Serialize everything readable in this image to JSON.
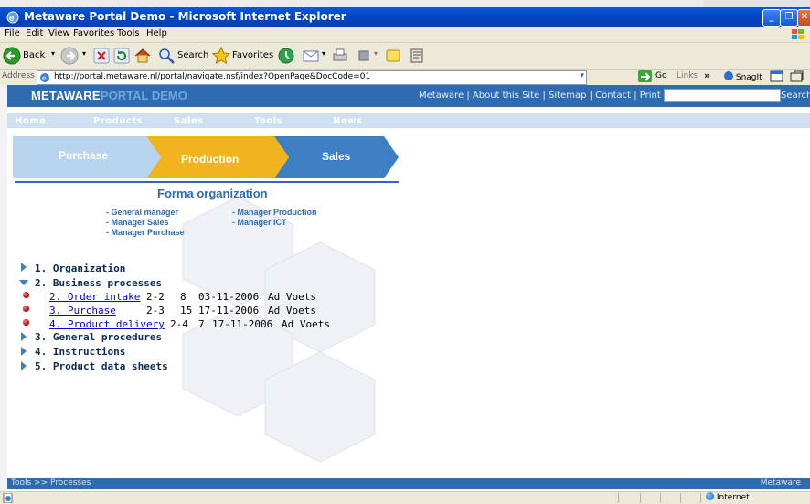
{
  "window": {
    "title": "Metaware Portal Demo - Microsoft Internet Explorer"
  },
  "menu": [
    "File",
    "Edit",
    "View",
    "Favorites",
    "Tools",
    "Help"
  ],
  "toolbar": {
    "back": "Back",
    "search": "Search",
    "favorites": "Favorites"
  },
  "address": {
    "label": "Address",
    "url": "http://portal.metaware.nl/portal/navigate.nsf/index?OpenPage&DocCode=01",
    "go": "Go",
    "links": "Links",
    "snagit": "SnagIt"
  },
  "portal": {
    "logo_part1": "METAWARE",
    "logo_part2": "PORTAL DEMO",
    "top_links": "Metaware | About this Site | Sitemap | Contact | Print",
    "search_label": "Search",
    "nav": [
      "Home",
      "Products",
      "Sales",
      "Tools",
      "News"
    ]
  },
  "process_arrows": [
    {
      "label": "Purchase",
      "color": "#b9d4ee"
    },
    {
      "label": "Production",
      "color": "#f0b41e"
    },
    {
      "label": "Sales",
      "color": "#3d7fc3"
    }
  ],
  "forma": {
    "title": "Forma organization",
    "links": [
      "- General manager",
      "- Manager Sales",
      "- Manager Purchase",
      "- Manager Production",
      "- Manager ICT"
    ]
  },
  "tree": {
    "items": [
      {
        "label": "1. Organization",
        "expanded": false
      },
      {
        "label": "2. Business processes",
        "expanded": true
      },
      {
        "label": "3. General procedures",
        "expanded": false
      },
      {
        "label": "4. Instructions",
        "expanded": false
      },
      {
        "label": "5. Product data sheets",
        "expanded": false
      }
    ],
    "documents": [
      {
        "title": "2. Order intake",
        "code": "2-2",
        "version": "8",
        "date": "03-11-2006",
        "author": "Ad Voets"
      },
      {
        "title": "3. Purchase",
        "code": "2-3",
        "version": "15",
        "date": "17-11-2006",
        "author": "Ad Voets"
      },
      {
        "title": "4. Product delivery",
        "code": "2-4",
        "version": "7",
        "date": "17-11-2006",
        "author": "Ad Voets"
      }
    ]
  },
  "footer": {
    "breadcrumb": "Tools >> Processes",
    "brand": "Metaware"
  },
  "status": {
    "zone": "Internet"
  }
}
